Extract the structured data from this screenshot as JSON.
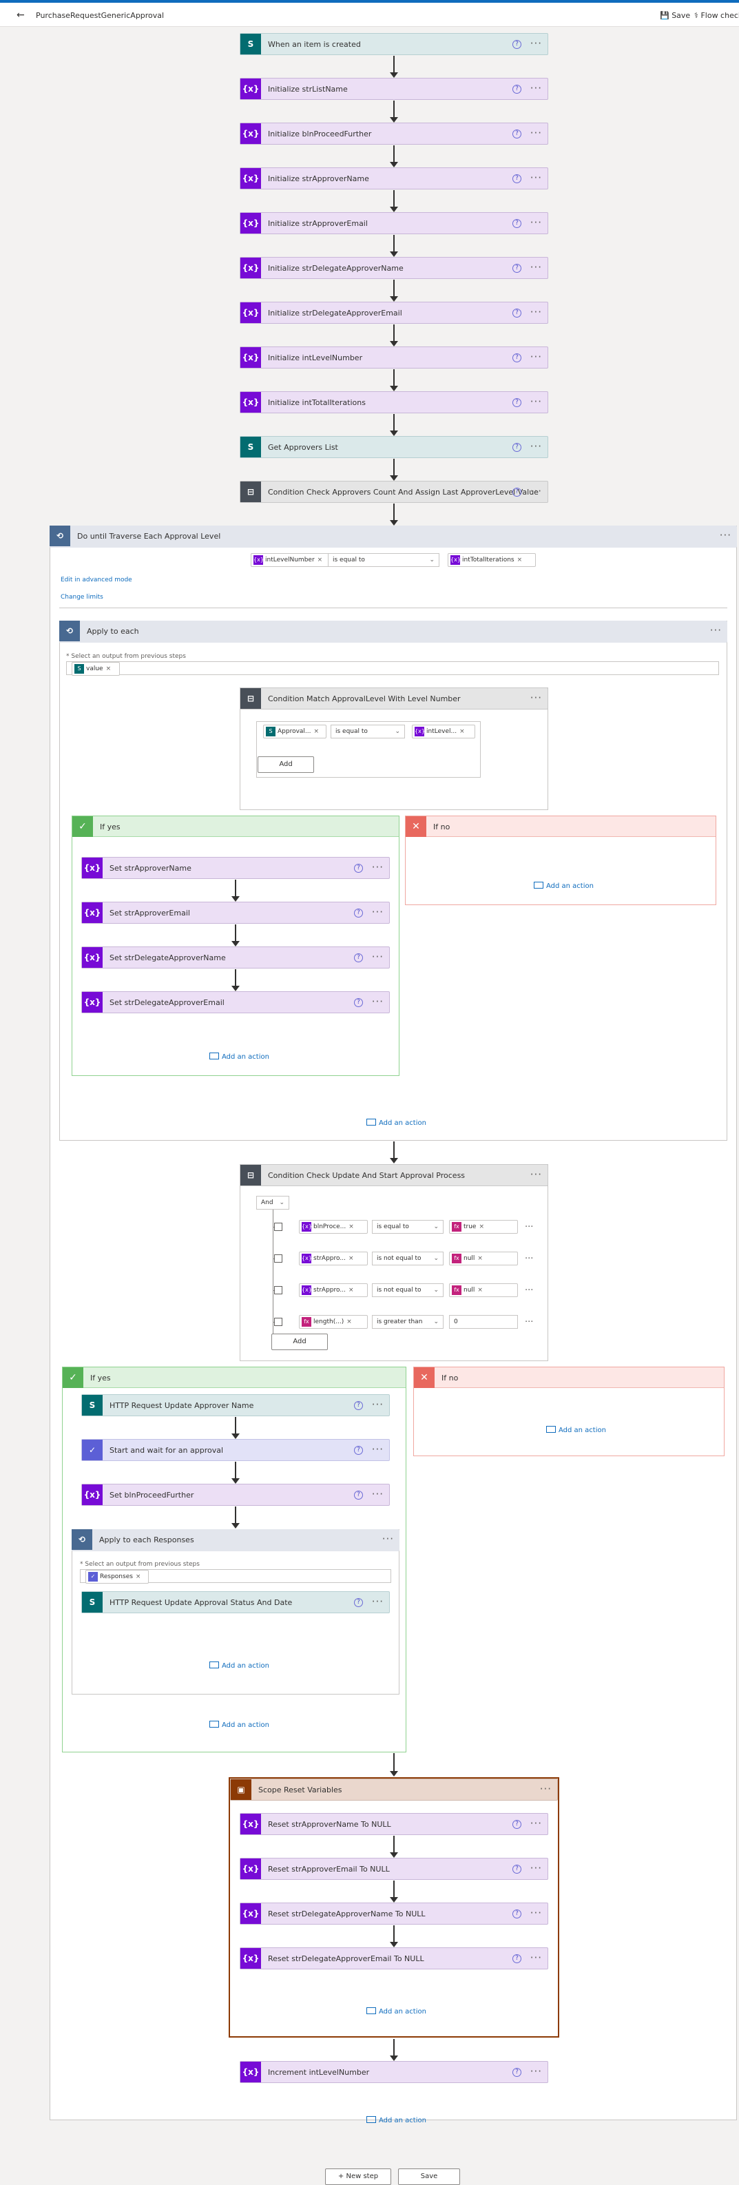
{
  "topbar": {
    "back_glyph": "←",
    "title": "PurchaseRequestGenericApproval",
    "save_label": "Save",
    "flow_checker_label": "Flow checker"
  },
  "top_steps": [
    {
      "label": "When an item is created",
      "icon": "sharepoint-icon"
    },
    {
      "label": "Initialize strListName",
      "icon": "variable-icon"
    },
    {
      "label": "Initialize blnProceedFurther",
      "icon": "variable-icon"
    },
    {
      "label": "Initialize strApproverName",
      "icon": "variable-icon"
    },
    {
      "label": "Initialize strApproverEmail",
      "icon": "variable-icon"
    },
    {
      "label": "Initialize strDelegateApproverName",
      "icon": "variable-icon"
    },
    {
      "label": "Initialize strDelegateApproverEmail",
      "icon": "variable-icon"
    },
    {
      "label": "Initialize intLevelNumber",
      "icon": "variable-icon"
    },
    {
      "label": "Initialize intTotalIterations",
      "icon": "variable-icon"
    },
    {
      "label": "Get Approvers List",
      "icon": "sharepoint-icon"
    },
    {
      "label": "Condition Check Approvers Count And Assign Last ApproverLevel Value",
      "icon": "condition-icon"
    }
  ],
  "do_until": {
    "title": "Do until Traverse Each Approval Level",
    "left_token": "intLevelNumber",
    "operator": "is equal to",
    "right_token": "intTotalIterations",
    "edit_advanced": "Edit in advanced mode",
    "change_limits": "Change limits",
    "apply_each": {
      "title": "Apply to each",
      "select_label": "* Select an output from previous steps",
      "select_token": "value",
      "condition": {
        "title": "Condition Match ApprovalLevel With Level Number",
        "left": "Approval...",
        "op": "is equal to",
        "right": "intLevel...",
        "add": "Add"
      },
      "if_yes": {
        "title": "If yes",
        "steps": [
          "Set strApproverName",
          "Set strApproverEmail",
          "Set strDelegateApproverName",
          "Set strDelegateApproverEmail"
        ],
        "add_action": "Add an action"
      },
      "if_no": {
        "title": "If no",
        "add_action": "Add an action"
      },
      "add_action": "Add an action"
    },
    "condition2": {
      "title": "Condition Check Update And Start Approval Process",
      "group_op": "And",
      "rows": [
        {
          "left": "blnProce...",
          "op": "is equal to",
          "right": "true",
          "right_kind": "fx"
        },
        {
          "left": "strAppro...",
          "op": "is not equal to",
          "right": "null",
          "right_kind": "fx"
        },
        {
          "left": "strAppro...",
          "op": "is not equal to",
          "right": "null",
          "right_kind": "fx"
        },
        {
          "left": "length(...)",
          "op": "is greater than",
          "right": "0",
          "right_kind": "text"
        }
      ],
      "add": "Add"
    },
    "if_yes2": {
      "title": "If yes",
      "steps": [
        {
          "label": "HTTP Request Update Approver Name",
          "icon": "sharepoint-icon"
        },
        {
          "label": "Start and wait for an approval",
          "icon": "approval-icon"
        },
        {
          "label": "Set blnProceedFurther",
          "icon": "variable-icon"
        }
      ],
      "apply_responses": {
        "title": "Apply to each Responses",
        "select_label": "* Select an output from previous steps",
        "select_token": "Responses",
        "step": "HTTP Request Update Approval Status And Date",
        "add_action": "Add an action"
      },
      "add_action": "Add an action"
    },
    "if_no2": {
      "title": "If no",
      "add_action": "Add an action"
    },
    "scope": {
      "title": "Scope Reset Variables",
      "steps": [
        "Reset strApproverName To NULL",
        "Reset strApproverEmail To NULL",
        "Reset strDelegateApproverName To NULL",
        "Reset strDelegateApproverEmail To NULL"
      ],
      "add_action": "Add an action"
    },
    "increment": "Increment intLevelNumber",
    "add_action": "Add an action"
  },
  "footer": {
    "new_step": "+ New step",
    "save": "Save"
  },
  "glyphs": {
    "var": "{x}",
    "fx": "fx",
    "more": "···",
    "help": "?",
    "chevron": "⌄",
    "close": "×"
  }
}
